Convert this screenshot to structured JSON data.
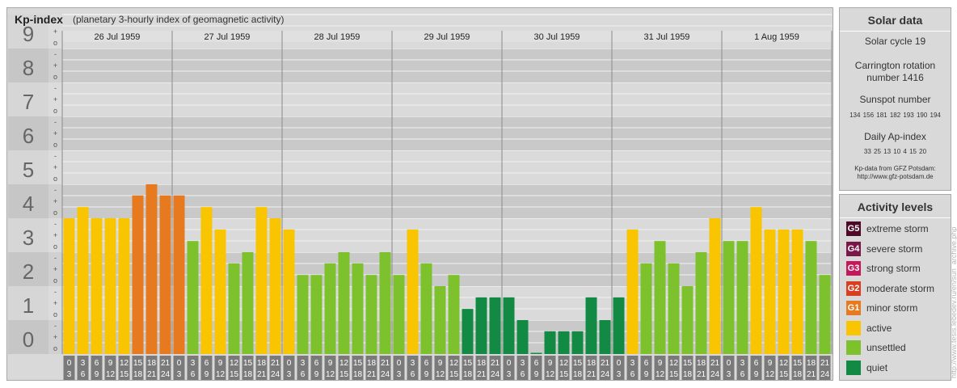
{
  "header": {
    "title": "Kp-index",
    "subtitle": "(planetary 3-hourly index of geomagnetic activity)"
  },
  "chart_data": {
    "type": "bar",
    "ylim": [
      0,
      9
    ],
    "y_major_ticks": [
      "0",
      "1",
      "2",
      "3",
      "4",
      "5",
      "6",
      "7",
      "8",
      "9"
    ],
    "y_minor_ticks": [
      "o",
      "+",
      "-"
    ],
    "days": [
      "26 Jul 1959",
      "27 Jul 1959",
      "28 Jul 1959",
      "29 Jul 1959",
      "30 Jul 1959",
      "31 Jul 1959",
      "1 Aug 1959"
    ],
    "interval_labels": [
      [
        "0",
        "3"
      ],
      [
        "3",
        "6"
      ],
      [
        "6",
        "9"
      ],
      [
        "9",
        "12"
      ],
      [
        "12",
        "15"
      ],
      [
        "15",
        "18"
      ],
      [
        "18",
        "21"
      ],
      [
        "21",
        "24"
      ]
    ],
    "values": [
      [
        4.0,
        4.33,
        4.0,
        4.0,
        4.0,
        4.67,
        5.0,
        4.67
      ],
      [
        4.67,
        3.33,
        4.33,
        3.67,
        2.67,
        3.0,
        4.33,
        4.0
      ],
      [
        3.67,
        2.33,
        2.33,
        2.67,
        3.0,
        2.67,
        2.33,
        3.0
      ],
      [
        2.33,
        3.67,
        2.67,
        2.0,
        2.33,
        1.33,
        1.67,
        1.67
      ],
      [
        1.67,
        1.0,
        0.0,
        0.67,
        0.67,
        0.67,
        1.67,
        1.0
      ],
      [
        1.67,
        3.67,
        2.67,
        3.33,
        2.67,
        2.0,
        3.0,
        4.0
      ],
      [
        3.33,
        3.33,
        4.33,
        3.67,
        3.67,
        3.67,
        3.33,
        2.33
      ]
    ],
    "colors": {
      "quiet": "#138a44",
      "unsettled": "#7dc12c",
      "active": "#f8c500",
      "minor": "#e7791f",
      "moderate": "#d93f1f",
      "strong": "#c7175b",
      "severe": "#7a1648",
      "extreme": "#4c0a27"
    }
  },
  "solar": {
    "title": "Solar data",
    "solar_cycle": "Solar cycle 19",
    "carrington_line1": "Carrington rotation",
    "carrington_line2": "number 1416",
    "sunspot_title": "Sunspot number",
    "sunspot_values": "134 156 181 182 193 190 194",
    "ap_title": "Daily Ap-index",
    "ap_values": "33 25 13 10 4 15 20",
    "source_line1": "Kp-data from GFZ Potsdam:",
    "source_line2": "http://www.gfz-potsdam.de"
  },
  "activity": {
    "title": "Activity levels",
    "levels": [
      {
        "badge": "G5",
        "label": "extreme storm",
        "color": "#4c0a27"
      },
      {
        "badge": "G4",
        "label": "severe storm",
        "color": "#7a1648"
      },
      {
        "badge": "G3",
        "label": "strong storm",
        "color": "#c7175b"
      },
      {
        "badge": "G2",
        "label": "moderate storm",
        "color": "#d93f1f"
      },
      {
        "badge": "G1",
        "label": "minor storm",
        "color": "#e7791f"
      },
      {
        "badge": "",
        "label": "active",
        "color": "#f8c500"
      },
      {
        "badge": "",
        "label": "unsettled",
        "color": "#7dc12c"
      },
      {
        "badge": "",
        "label": "quiet",
        "color": "#138a44"
      }
    ]
  },
  "credit": "http://www.tesis.lebedev.ru/en/sun_archive.php"
}
